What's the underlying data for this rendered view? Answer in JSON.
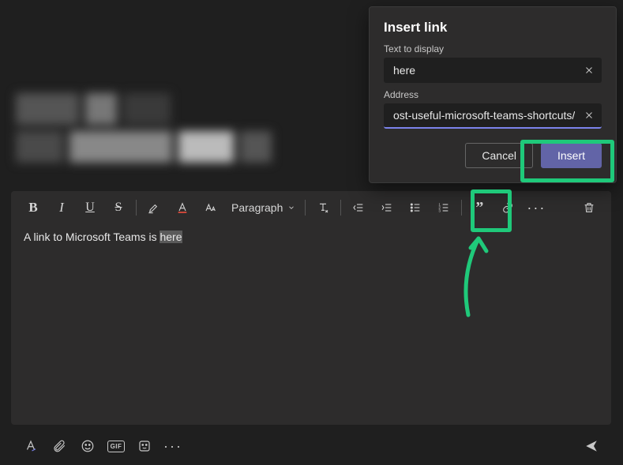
{
  "dialog": {
    "title": "Insert link",
    "text_label": "Text to display",
    "text_value": "here",
    "address_label": "Address",
    "address_value": "ost-useful-microsoft-teams-shortcuts/",
    "cancel": "Cancel",
    "insert": "Insert"
  },
  "toolbar": {
    "paragraph_label": "Paragraph"
  },
  "editor": {
    "text_before": "A link to Microsoft Teams is ",
    "text_selected": "here"
  },
  "bottombar": {
    "gif_label": "GIF"
  }
}
